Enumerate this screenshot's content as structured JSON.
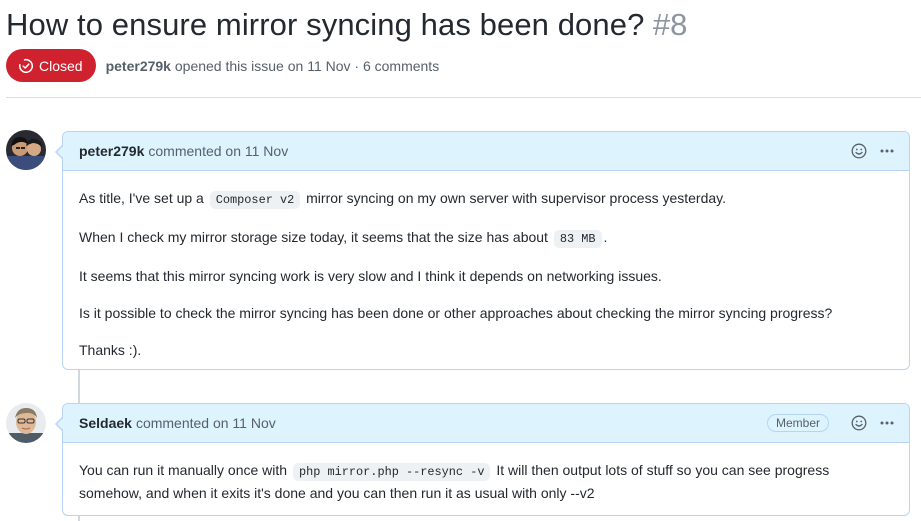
{
  "issue": {
    "title": "How to ensure mirror syncing has been done?",
    "number": "#8",
    "state": "Closed",
    "author": "peter279k",
    "meta_suffix": "opened this issue on 11 Nov · 6 comments"
  },
  "comments": [
    {
      "author": "peter279k",
      "action": "commented on 11 Nov",
      "body": {
        "p1_before": "As title, I've set up a",
        "p1_code": "Composer v2",
        "p1_after": "mirror syncing on my own server with supervisor process yesterday.",
        "p2_before": "When I check my mirror storage size today, it seems that the size has about",
        "p2_code": "83 MB",
        "p2_after": ".",
        "p3": "It seems that this mirror syncing work is very slow and I think it depends on networking issues.",
        "p4": "Is it possible to check the mirror syncing has been done or other approaches about checking the mirror syncing progress?",
        "p5": "Thanks :)."
      }
    },
    {
      "author": "Seldaek",
      "action": "commented on 11 Nov",
      "role": "Member",
      "body": {
        "p1_before": "You can run it manually once with",
        "p1_code": "php mirror.php --resync -v",
        "p1_after": "It will then output lots of stuff so you can see progress somehow, and when it exits it's done and you can then run it as usual with only --v2"
      }
    }
  ],
  "icons": {
    "state": "issue-closed-icon",
    "reaction": "smiley-icon",
    "more": "kebab-horizontal-icon"
  },
  "colors": {
    "closed_badge": "#cf222e",
    "header_bg": "#ddf4ff",
    "header_border": "#b6d4f5"
  }
}
